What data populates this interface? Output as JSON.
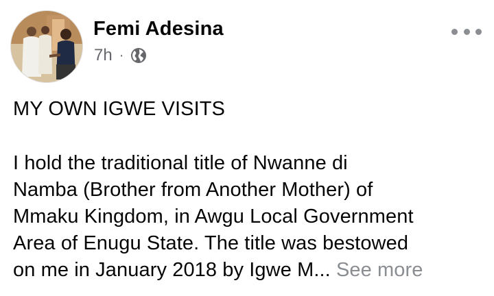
{
  "post": {
    "author": "Femi Adesina",
    "time": "7h",
    "separator": "·",
    "privacy_icon": "globe-icon",
    "options_icon": "more-horizontal-icon",
    "title_line": "MY OWN IGWE VISITS",
    "lines": [
      "I hold the traditional title of Nwanne di",
      "Namba (Brother from Another Mother) of",
      "Mmaku Kingdom, in Awgu Local Government",
      "Area of Enugu State. The title was bestowed"
    ],
    "last_line": "on me in January 2018 by Igwe M...",
    "see_more": "See more",
    "avatar_icon": "profile-photo-avatar"
  },
  "colors": {
    "text": "#050505",
    "secondary": "#65676b",
    "see_more": "#8a8d91"
  }
}
